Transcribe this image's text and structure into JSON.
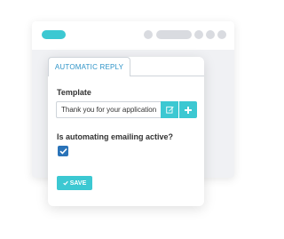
{
  "colors": {
    "accent": "#3cc8d2",
    "tab_text": "#2f94c8",
    "checkbox": "#2a73b8",
    "placeholder_gray": "#d9dbe0",
    "icon_white": "#ffffff"
  },
  "browser": {
    "accent_pill": "accent-pill",
    "controls": [
      "control-pill",
      "control-dot",
      "control-dot",
      "control-dot"
    ]
  },
  "form": {
    "tab_label": "AUTOMATIC REPLY",
    "template_label": "Template",
    "template_value": "Thank you for your application",
    "edit_icon": "pencil-edit-icon",
    "add_icon": "plus-icon",
    "active_label": "Is automating emailing active?",
    "active_checked": true,
    "save_label": "SAVE",
    "save_icon": "check-icon"
  }
}
